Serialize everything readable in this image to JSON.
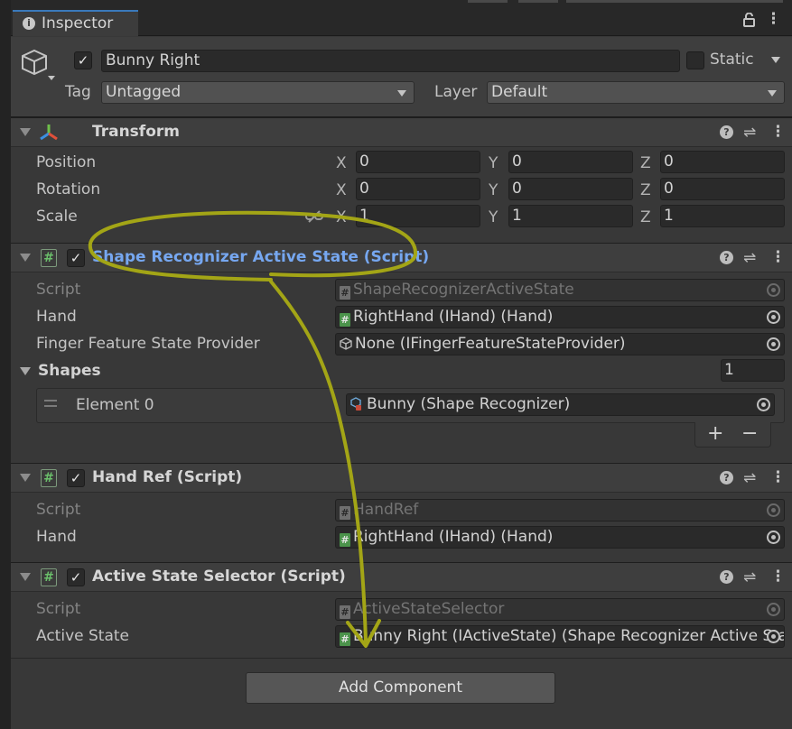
{
  "window": {
    "tab_label": "Inspector",
    "lock_icon": "lock-icon",
    "more_icon": "kebab-menu-icon"
  },
  "gameobject": {
    "name": "Bunny Right",
    "active": true,
    "static_label": "Static",
    "static": false,
    "tag_label": "Tag",
    "tag_value": "Untagged",
    "layer_label": "Layer",
    "layer_value": "Default"
  },
  "transform": {
    "title": "Transform",
    "rows": [
      {
        "label": "Position",
        "x": "0",
        "y": "0",
        "z": "0"
      },
      {
        "label": "Rotation",
        "x": "0",
        "y": "0",
        "z": "0"
      },
      {
        "label": "Scale",
        "x": "1",
        "y": "1",
        "z": "1"
      }
    ],
    "axis": {
      "x": "X",
      "y": "Y",
      "z": "Z"
    }
  },
  "shape_recognizer": {
    "title": "Shape Recognizer Active State (Script)",
    "enabled": true,
    "script_label": "Script",
    "script_value": "ShapeRecognizerActiveState",
    "hand_label": "Hand",
    "hand_value": "RightHand (IHand) (Hand)",
    "finger_label": "Finger Feature State Provider",
    "finger_value": "None (IFingerFeatureStateProvider)",
    "shapes_label": "Shapes",
    "shapes_count": "1",
    "element_label": "Element 0",
    "element_value": "Bunny (Shape Recognizer)",
    "plus": "+",
    "minus": "−"
  },
  "hand_ref": {
    "title": "Hand Ref (Script)",
    "enabled": true,
    "script_label": "Script",
    "script_value": "HandRef",
    "hand_label": "Hand",
    "hand_value": "RightHand (IHand) (Hand)"
  },
  "active_state_selector": {
    "title": "Active State Selector (Script)",
    "enabled": true,
    "script_label": "Script",
    "script_value": "ActiveStateSelector",
    "active_state_label": "Active State",
    "active_state_value": "Bunny Right (IActiveState) (Shape Recognizer Active State)"
  },
  "add_component_label": "Add Component",
  "colors": {
    "annotation": "#a3a516",
    "title_blue": "#76a7f0",
    "script_green": "#6abf6a"
  }
}
